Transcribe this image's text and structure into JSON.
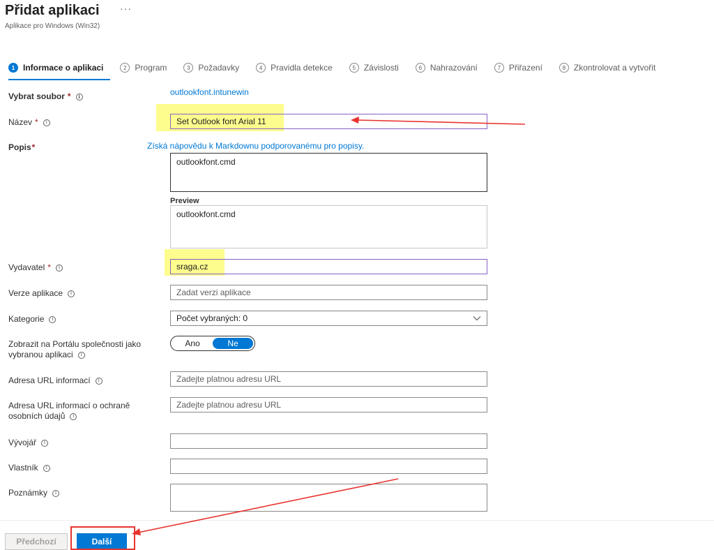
{
  "header": {
    "title": "Přidat aplikaci",
    "more": "···",
    "subtitle": "Aplikace pro Windows (Win32)"
  },
  "steps": [
    {
      "num": "1",
      "label": "Informace o aplikaci"
    },
    {
      "num": "2",
      "label": "Program"
    },
    {
      "num": "3",
      "label": "Požadavky"
    },
    {
      "num": "4",
      "label": "Pravidla detekce"
    },
    {
      "num": "5",
      "label": "Závislosti"
    },
    {
      "num": "6",
      "label": "Nahrazování"
    },
    {
      "num": "7",
      "label": "Přiřazení"
    },
    {
      "num": "8",
      "label": "Zkontrolovat a vytvořit"
    }
  ],
  "form": {
    "select_file": {
      "label": "Vybrat soubor",
      "value": "outlookfont.intunewin"
    },
    "name": {
      "label": "Název",
      "value": "Set Outlook font Arial 11"
    },
    "description": {
      "label": "Popis",
      "help_link": "Získá nápovědu k Markdownu podporovanému pro popisy.",
      "value": "outlookfont.cmd",
      "preview_label": "Preview",
      "preview_value": "outlookfont.cmd"
    },
    "publisher": {
      "label": "Vydavatel",
      "value": "sraga.cz"
    },
    "version": {
      "label": "Verze aplikace",
      "placeholder": "Zadat verzi aplikace"
    },
    "category": {
      "label": "Kategorie",
      "value": "Počet vybraných: 0"
    },
    "featured": {
      "label_line1": "Zobrazit na Portálu společnosti jako",
      "label_line2": "vybranou aplikaci",
      "option_yes": "Ano",
      "option_no": "Ne"
    },
    "info_url": {
      "label": "Adresa URL informací",
      "placeholder": "Zadejte platnou adresu URL"
    },
    "privacy_url": {
      "label_line1": "Adresa URL informací o ochraně",
      "label_line2": "osobních údajů",
      "placeholder": "Zadejte platnou adresu URL"
    },
    "developer": {
      "label": "Vývojář",
      "value": ""
    },
    "owner": {
      "label": "Vlastník",
      "value": ""
    },
    "notes": {
      "label": "Poznámky",
      "value": ""
    }
  },
  "footer": {
    "prev_label": "Předchozí",
    "next_label": "Další"
  },
  "colors": {
    "accent": "#0078d4",
    "annotation": "#e8332e",
    "highlight": "#fdfd7a"
  }
}
